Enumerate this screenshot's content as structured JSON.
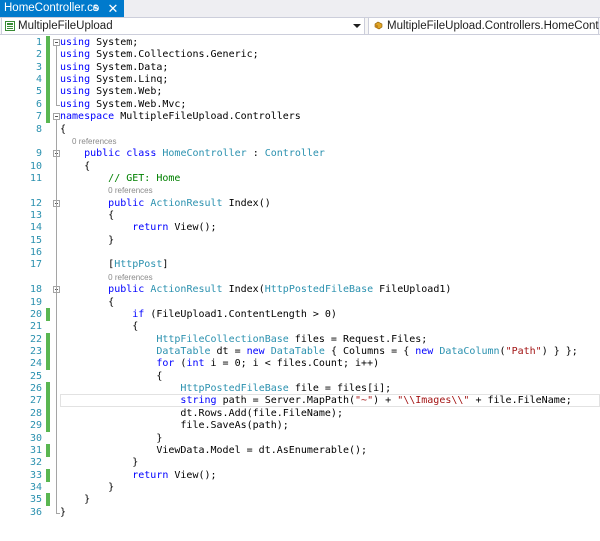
{
  "tab": {
    "filename": "HomeController.cs",
    "pin": "⊕",
    "close": "✕"
  },
  "nav": {
    "project": "MultipleFileUpload",
    "class": "MultipleFileUpload.Controllers.HomeController"
  },
  "colors": {
    "keyword": "#0000ff",
    "type": "#2b91af",
    "string": "#a31515",
    "comment": "#008000",
    "linenumber": "#2b91af",
    "changed_marker": "#5ab651",
    "tab_active": "#007acc"
  },
  "icons": {
    "project": "csharp-project-icon",
    "class": "class-icon",
    "pin": "pin-icon",
    "close": "close-icon"
  },
  "code_lines": [
    {
      "number": "1",
      "changed": true,
      "tokens": [
        [
          "k",
          "using"
        ],
        [
          "p",
          " System;"
        ]
      ]
    },
    {
      "number": "2",
      "changed": true,
      "tokens": [
        [
          "k",
          "using"
        ],
        [
          "p",
          " System.Collections.Generic;"
        ]
      ]
    },
    {
      "number": "3",
      "changed": true,
      "tokens": [
        [
          "k",
          "using"
        ],
        [
          "p",
          " System.Data;"
        ]
      ]
    },
    {
      "number": "4",
      "changed": true,
      "tokens": [
        [
          "k",
          "using"
        ],
        [
          "p",
          " System.Linq;"
        ]
      ]
    },
    {
      "number": "5",
      "changed": true,
      "tokens": [
        [
          "k",
          "using"
        ],
        [
          "p",
          " System.Web;"
        ]
      ]
    },
    {
      "number": "6",
      "changed": true,
      "tokens": [
        [
          "k",
          "using"
        ],
        [
          "p",
          " System.Web.Mvc;"
        ]
      ]
    },
    {
      "number": "7",
      "changed": true,
      "tokens": [
        [
          "k",
          "namespace"
        ],
        [
          "p",
          " MultipleFileUpload.Controllers"
        ]
      ]
    },
    {
      "number": "8",
      "changed": false,
      "tokens": [
        [
          "p",
          "{"
        ]
      ]
    },
    {
      "references": "0 references",
      "indent": 2
    },
    {
      "number": "9",
      "changed": false,
      "tokens": [
        [
          "p",
          "    "
        ],
        [
          "k",
          "public"
        ],
        [
          "p",
          " "
        ],
        [
          "k",
          "class"
        ],
        [
          "p",
          " "
        ],
        [
          "t",
          "HomeController"
        ],
        [
          "p",
          " : "
        ],
        [
          "t",
          "Controller"
        ]
      ]
    },
    {
      "number": "10",
      "changed": false,
      "tokens": [
        [
          "p",
          "    {"
        ]
      ]
    },
    {
      "number": "11",
      "changed": false,
      "tokens": [
        [
          "p",
          "        "
        ],
        [
          "c",
          "// GET: Home"
        ]
      ]
    },
    {
      "references": "0 references",
      "indent": 8
    },
    {
      "number": "12",
      "changed": false,
      "tokens": [
        [
          "p",
          "        "
        ],
        [
          "k",
          "public"
        ],
        [
          "p",
          " "
        ],
        [
          "t",
          "ActionResult"
        ],
        [
          "p",
          " Index()"
        ]
      ]
    },
    {
      "number": "13",
      "changed": false,
      "tokens": [
        [
          "p",
          "        {"
        ]
      ]
    },
    {
      "number": "14",
      "changed": false,
      "tokens": [
        [
          "p",
          "            "
        ],
        [
          "k",
          "return"
        ],
        [
          "p",
          " View();"
        ]
      ]
    },
    {
      "number": "15",
      "changed": false,
      "tokens": [
        [
          "p",
          "        }"
        ]
      ]
    },
    {
      "number": "16",
      "changed": false,
      "tokens": []
    },
    {
      "number": "17",
      "changed": false,
      "tokens": [
        [
          "p",
          "        ["
        ],
        [
          "t",
          "HttpPost"
        ],
        [
          "p",
          "]"
        ]
      ]
    },
    {
      "references": "0 references",
      "indent": 8
    },
    {
      "number": "18",
      "changed": false,
      "tokens": [
        [
          "p",
          "        "
        ],
        [
          "k",
          "public"
        ],
        [
          "p",
          " "
        ],
        [
          "t",
          "ActionResult"
        ],
        [
          "p",
          " Index("
        ],
        [
          "t",
          "HttpPostedFileBase"
        ],
        [
          "p",
          " FileUpload1)"
        ]
      ]
    },
    {
      "number": "19",
      "changed": false,
      "tokens": [
        [
          "p",
          "        {"
        ]
      ]
    },
    {
      "number": "20",
      "changed": true,
      "tokens": [
        [
          "p",
          "            "
        ],
        [
          "k",
          "if"
        ],
        [
          "p",
          " (FileUpload1.ContentLength > 0)"
        ]
      ]
    },
    {
      "number": "21",
      "changed": false,
      "tokens": [
        [
          "p",
          "            {"
        ]
      ]
    },
    {
      "number": "22",
      "changed": true,
      "tokens": [
        [
          "p",
          "                "
        ],
        [
          "t",
          "HttpFileCollectionBase"
        ],
        [
          "p",
          " files = Request.Files;"
        ]
      ]
    },
    {
      "number": "23",
      "changed": true,
      "tokens": [
        [
          "p",
          "                "
        ],
        [
          "t",
          "DataTable"
        ],
        [
          "p",
          " dt = "
        ],
        [
          "k",
          "new"
        ],
        [
          "p",
          " "
        ],
        [
          "t",
          "DataTable"
        ],
        [
          "p",
          " { Columns = { "
        ],
        [
          "k",
          "new"
        ],
        [
          "p",
          " "
        ],
        [
          "t",
          "DataColumn"
        ],
        [
          "p",
          "("
        ],
        [
          "s",
          "\"Path\""
        ],
        [
          "p",
          ") } };"
        ]
      ]
    },
    {
      "number": "24",
      "changed": true,
      "tokens": [
        [
          "p",
          "                "
        ],
        [
          "k",
          "for"
        ],
        [
          "p",
          " ("
        ],
        [
          "k",
          "int"
        ],
        [
          "p",
          " i = 0; i < files.Count; i++)"
        ]
      ]
    },
    {
      "number": "25",
      "changed": false,
      "tokens": [
        [
          "p",
          "                {"
        ]
      ]
    },
    {
      "number": "26",
      "changed": true,
      "tokens": [
        [
          "p",
          "                    "
        ],
        [
          "t",
          "HttpPostedFileBase"
        ],
        [
          "p",
          " file = files[i];"
        ]
      ]
    },
    {
      "number": "27",
      "changed": true,
      "current": true,
      "tokens": [
        [
          "p",
          "                    "
        ],
        [
          "k",
          "string"
        ],
        [
          "p",
          " path = Server.MapPath("
        ],
        [
          "s",
          "\"~\""
        ],
        [
          "p",
          ") + "
        ],
        [
          "s",
          "\"\\\\Images\\\\\""
        ],
        [
          "p",
          " + file.FileName;"
        ]
      ]
    },
    {
      "number": "28",
      "changed": true,
      "tokens": [
        [
          "p",
          "                    dt.Rows.Add(file.FileName);"
        ]
      ]
    },
    {
      "number": "29",
      "changed": true,
      "tokens": [
        [
          "p",
          "                    file.SaveAs(path);"
        ]
      ]
    },
    {
      "number": "30",
      "changed": false,
      "tokens": [
        [
          "p",
          "                }"
        ]
      ]
    },
    {
      "number": "31",
      "changed": true,
      "tokens": [
        [
          "p",
          "                ViewData.Model = dt.AsEnumerable();"
        ]
      ]
    },
    {
      "number": "32",
      "changed": false,
      "tokens": [
        [
          "p",
          "            }"
        ]
      ]
    },
    {
      "number": "33",
      "changed": true,
      "tokens": [
        [
          "p",
          "            "
        ],
        [
          "k",
          "return"
        ],
        [
          "p",
          " View();"
        ]
      ]
    },
    {
      "number": "34",
      "changed": false,
      "tokens": [
        [
          "p",
          "        }"
        ]
      ]
    },
    {
      "number": "35",
      "changed": true,
      "tokens": [
        [
          "p",
          "    }"
        ]
      ]
    },
    {
      "number": "36",
      "changed": false,
      "tokens": [
        [
          "p",
          "}"
        ]
      ]
    }
  ]
}
